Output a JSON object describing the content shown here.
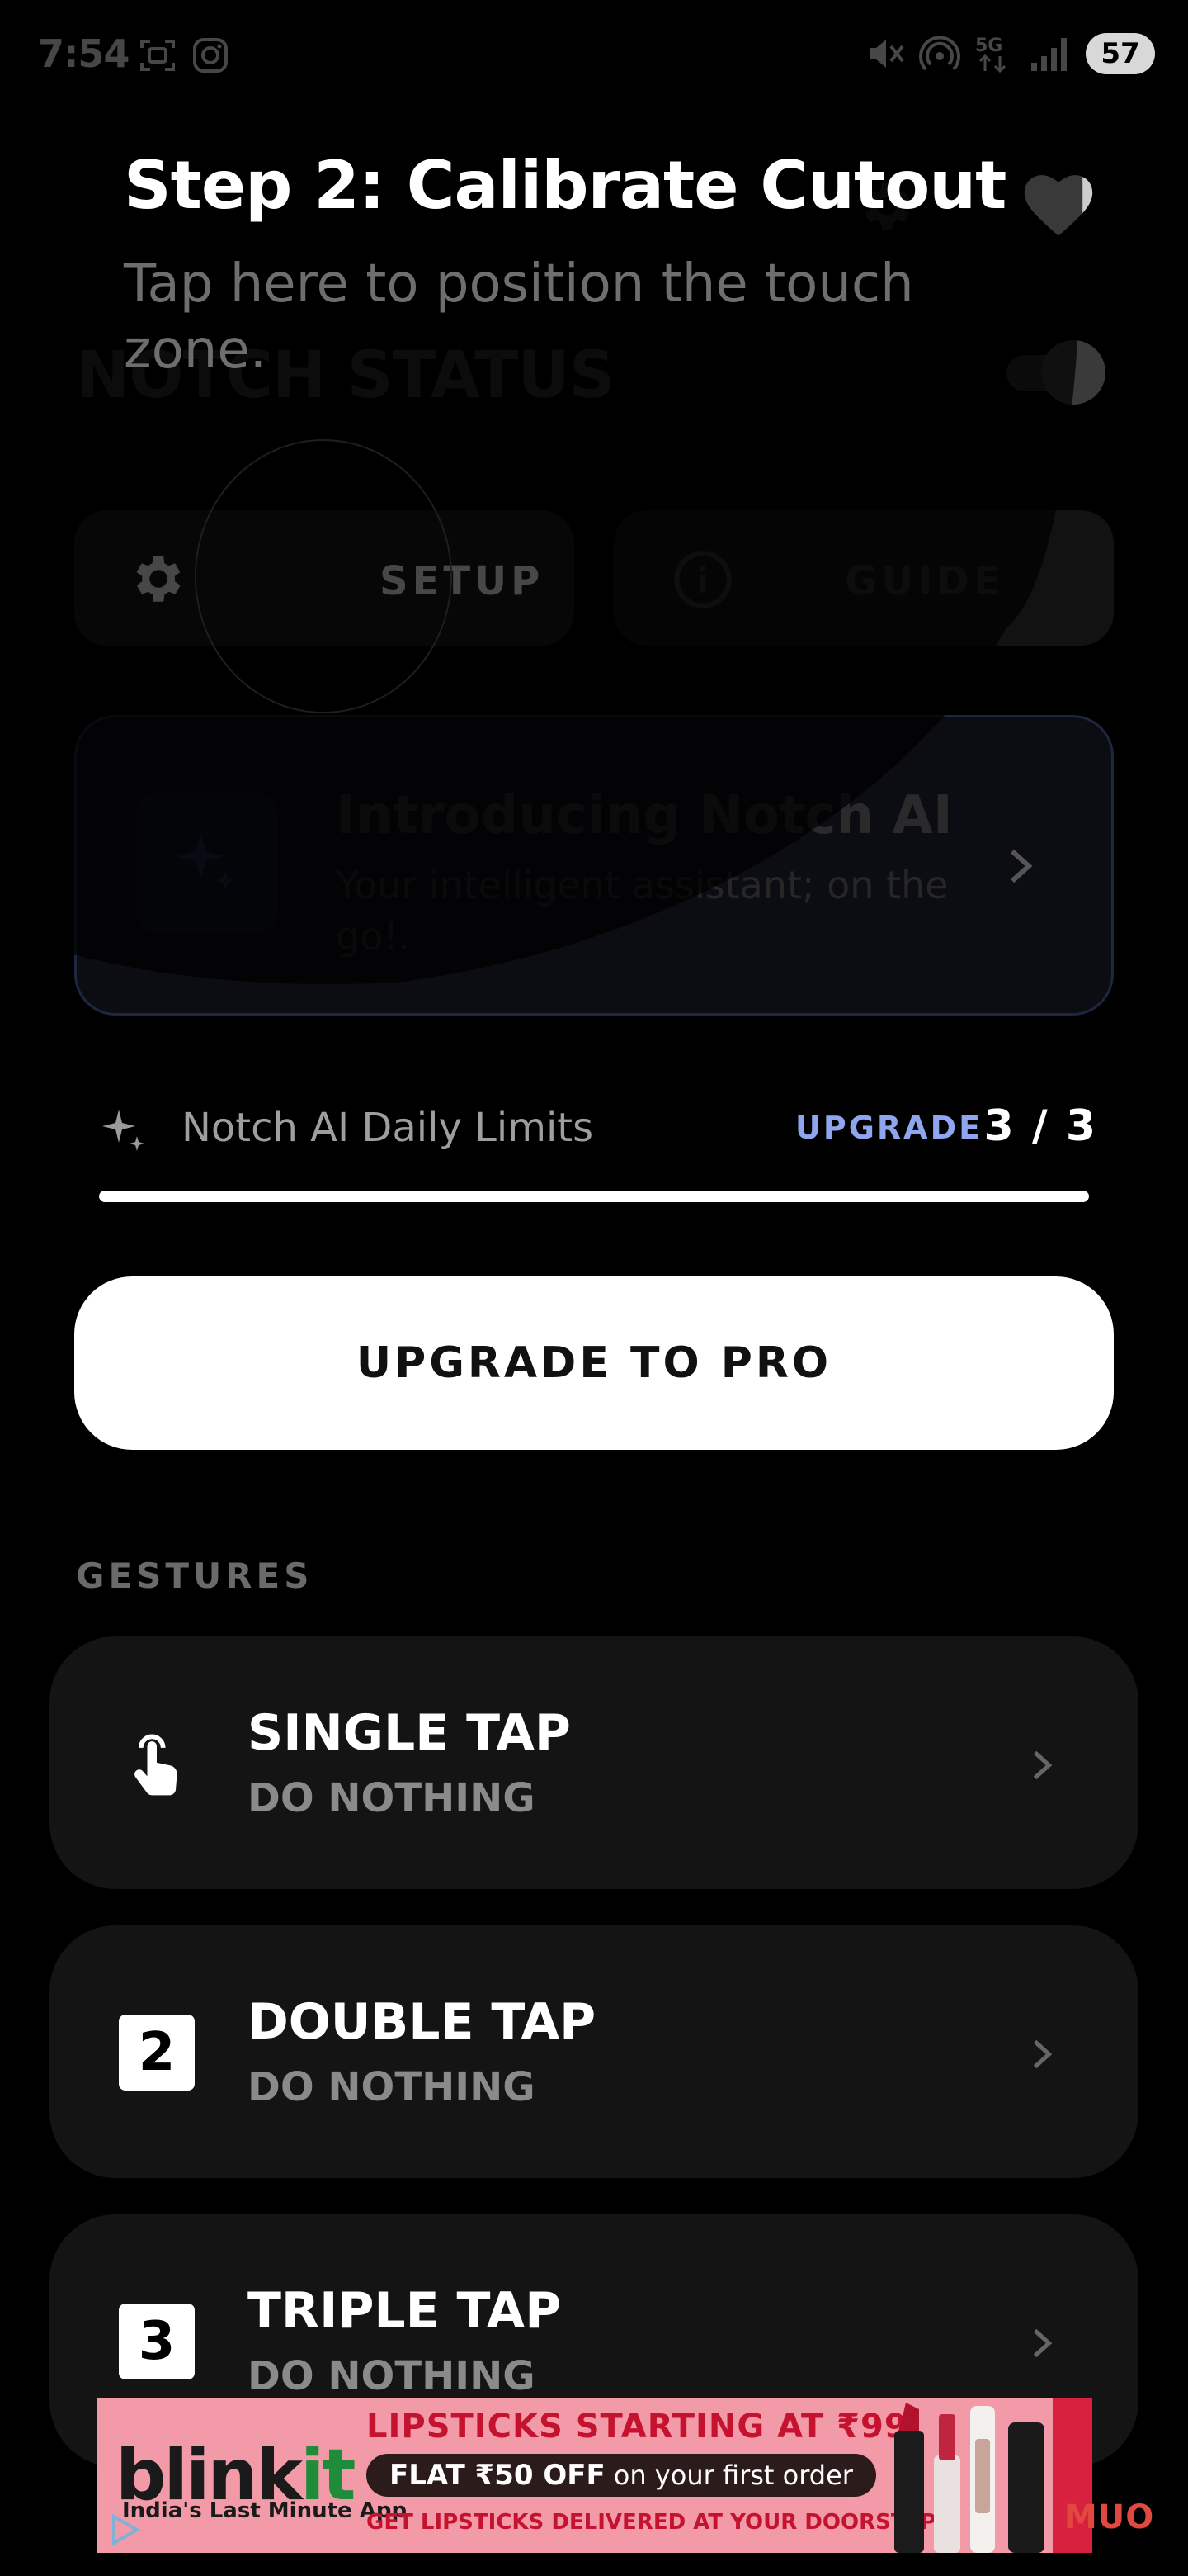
{
  "status_bar": {
    "time": "7:54",
    "battery": "57",
    "left_icons": [
      "screenshot-icon",
      "instagram-icon"
    ],
    "right_icons": [
      "mute-icon",
      "hotspot-icon",
      "5g-icon",
      "signal-icon"
    ]
  },
  "overlay": {
    "title": "Step 2: Calibrate Cutout",
    "subtitle": "Tap here to position the touch zone."
  },
  "header": {
    "notch_status_label": "NOTCH STATUS",
    "toggle_on": true
  },
  "actions": {
    "setup_label": "SETUP",
    "guide_label": "GUIDE"
  },
  "ai_card": {
    "title": "Introducing Notch AI",
    "subtitle": "Your intelligent assistant; on the go!."
  },
  "limits": {
    "label": "Notch AI Daily Limits",
    "upgrade_label": "UPGRADE",
    "count": "3 / 3",
    "used": 3,
    "total": 3
  },
  "upgrade_button": {
    "label": "UPGRADE TO PRO"
  },
  "gestures": {
    "header": "GESTURES",
    "items": [
      {
        "name": "SINGLE TAP",
        "value": "DO NOTHING",
        "icon": "tap-hand-icon"
      },
      {
        "name": "DOUBLE TAP",
        "value": "DO NOTHING",
        "icon": "number-2-icon",
        "glyph": "2"
      },
      {
        "name": "TRIPLE TAP",
        "value": "DO NOTHING",
        "icon": "number-3-icon",
        "glyph": "3"
      }
    ]
  },
  "ad": {
    "brand_a": "blink",
    "brand_b": "it",
    "tagline": "India's Last Minute App",
    "headline": "LIPSTICKS STARTING AT ₹99",
    "offer_bold": "FLAT ₹50 OFF",
    "offer_rest": "on your first order",
    "footer": "GET LIPSTICKS DELIVERED AT YOUR DOORSTEP"
  },
  "watermark": "MUO",
  "colors": {
    "accent_blue": "#8fa6ee",
    "ad_pink": "#f29aa8",
    "ad_red": "#c5122f"
  }
}
